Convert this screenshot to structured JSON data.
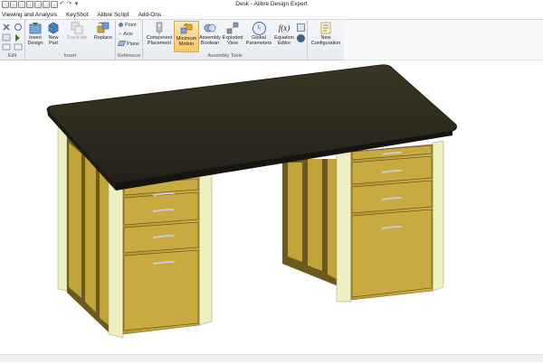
{
  "window": {
    "title": "Desk - Alibre Design Expert"
  },
  "menu": [
    "Viewing and Analysis",
    "KeyShot",
    "Alibre Script",
    "Add-Ons"
  ],
  "ribbon": {
    "groups": {
      "edit": "Edit",
      "insert": "Insert",
      "reference": "Reference",
      "assembly_tools": "Assembly Tools"
    },
    "buttons": {
      "insert_design": "Insert Design",
      "new_part": "New Part",
      "duplicate": "Duplicate",
      "replace": "Replace",
      "point": "Point",
      "axis": "Axis",
      "plane": "Plane",
      "component_placement": "Component Placement",
      "minimum_motion": "Minimum Motion",
      "assembly_boolean": "Assembly Boolean",
      "exploded_view": "Exploded View",
      "global_parameters": "Global Parameters",
      "equation_editor": "Equation Editor",
      "new_configuration": "New Configuration"
    },
    "active_button": "Minimum Motion",
    "icon_glyphs": {
      "global_parameters": "fₓ",
      "equation_editor": "f(x)"
    }
  },
  "model": {
    "name": "Desk",
    "colors": {
      "desktop": "#2e2a1b",
      "panel": "#c2a33a",
      "panel_dark": "#6b5a20",
      "frame": "#eef0c4",
      "handle": "#c9ccd2"
    }
  }
}
